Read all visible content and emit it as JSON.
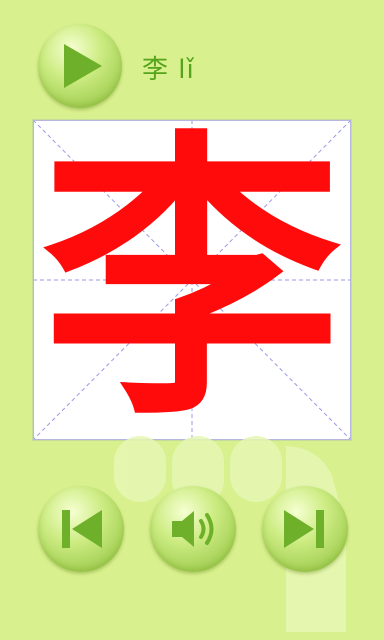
{
  "header": {
    "character": "李",
    "pinyin": "lǐ"
  },
  "writing_grid": {
    "character": "李"
  },
  "controls": {
    "play_icon": "play-icon",
    "previous_icon": "skip-previous-icon",
    "sound_icon": "speaker-icon",
    "next_icon": "skip-next-icon"
  },
  "colors": {
    "background": "#d9f08e",
    "character_stroke": "#ff0b0b",
    "label_text": "#55a41c",
    "icon": "#6fb02a"
  }
}
